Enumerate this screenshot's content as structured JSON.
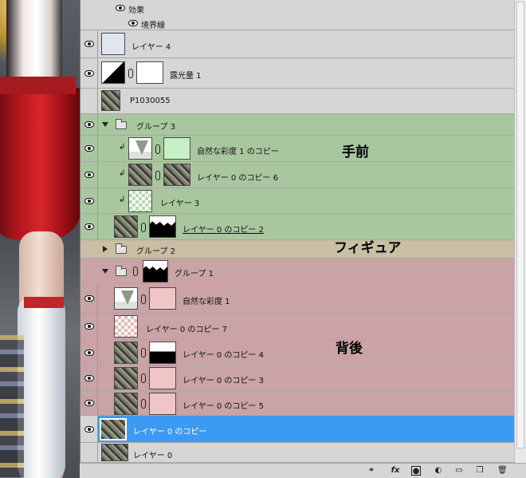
{
  "effects": {
    "header": "効果",
    "item": "境界線"
  },
  "layers": [
    {
      "label": "レイヤー 4"
    },
    {
      "label": "露光量 1"
    },
    {
      "label": "P1030055"
    },
    {
      "label": "グループ 3"
    },
    {
      "label": "自然な彩度 1 のコピー"
    },
    {
      "label": "レイヤー 0 のコピー 6"
    },
    {
      "label": "レイヤー 3"
    },
    {
      "label": "レイヤー 0 のコピー 2"
    },
    {
      "label": "グループ 2"
    },
    {
      "label": "グループ 1"
    },
    {
      "label": "自然な彩度 1"
    },
    {
      "label": "レイヤー 0 のコピー 7"
    },
    {
      "label": "レイヤー 0 のコピー 4"
    },
    {
      "label": "レイヤー 0 のコピー 3"
    },
    {
      "label": "レイヤー 0 のコピー 5"
    },
    {
      "label": "レイヤー 0 のコピー"
    },
    {
      "label": "レイヤー 0"
    }
  ],
  "annotations": {
    "front": "手前",
    "figure": "フィギュア",
    "back": "背後"
  },
  "footer": {
    "link": "link-icon",
    "fx": "fx",
    "mask": "mask-icon",
    "adjustment": "adjustment-icon",
    "folder": "folder-icon",
    "new_layer": "new-layer-icon",
    "trash": "trash-icon"
  },
  "colors": {
    "group3": "#a9c79f",
    "group2": "#c8bfa4",
    "group1": "#c9a3a5",
    "selected": "#3d9af2"
  }
}
